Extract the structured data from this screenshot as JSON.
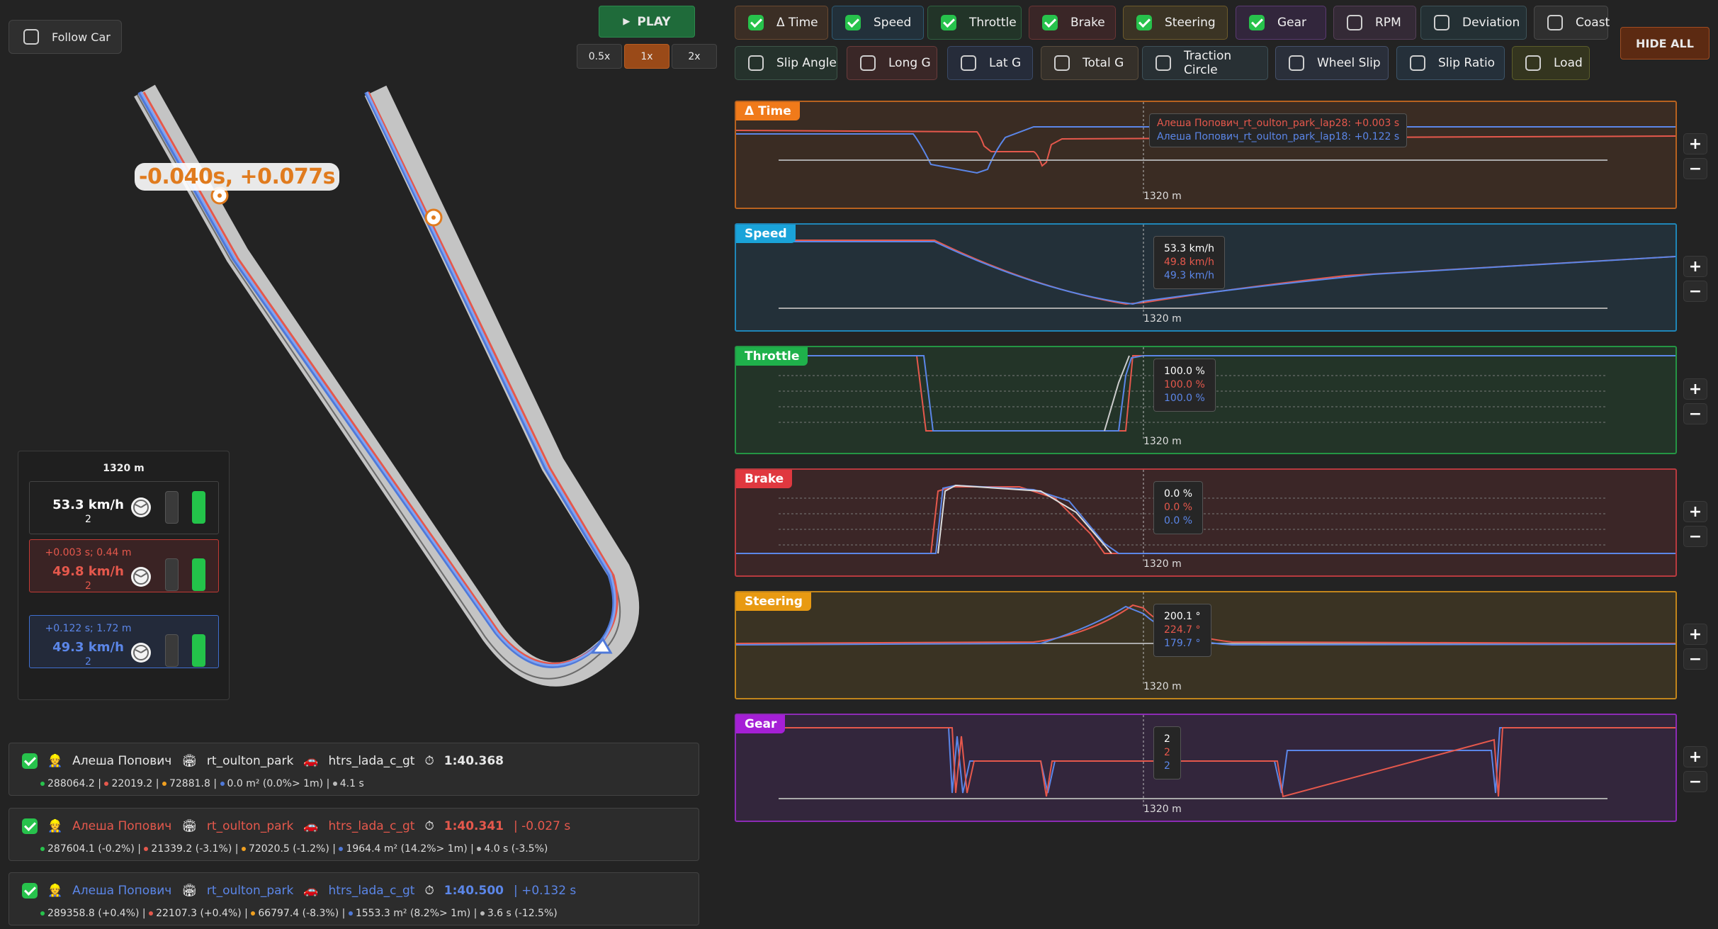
{
  "controls": {
    "follow_car": "Follow Car",
    "play": "PLAY",
    "speeds": [
      "0.5x",
      "1x",
      "2x"
    ],
    "hide_all": "HIDE ALL"
  },
  "toggles": [
    {
      "label": "Δ Time",
      "on": true,
      "bg": "#3b2e25",
      "border": "#6a4a31"
    },
    {
      "label": "Speed",
      "on": true,
      "bg": "#22303a",
      "border": "#2e5a72"
    },
    {
      "label": "Throttle",
      "on": true,
      "bg": "#223428",
      "border": "#2f6140"
    },
    {
      "label": "Brake",
      "on": true,
      "bg": "#3a2627",
      "border": "#6a3535"
    },
    {
      "label": "Steering",
      "on": true,
      "bg": "#3b3424",
      "border": "#6d5b2c"
    },
    {
      "label": "Gear",
      "on": true,
      "bg": "#32263c",
      "border": "#5b3a72"
    },
    {
      "label": "RPM",
      "on": false,
      "bg": "#342a36",
      "border": "#553f57"
    },
    {
      "label": "Deviation",
      "on": false,
      "bg": "#243034",
      "border": "#3d5358"
    },
    {
      "label": "Coast",
      "on": false,
      "bg": "#2f2f2f",
      "border": "#4a4a4a"
    },
    {
      "label": "Slip Angle",
      "on": false,
      "bg": "#25322c",
      "border": "#3d5548"
    },
    {
      "label": "Long G",
      "on": false,
      "bg": "#3a2727",
      "border": "#6a3c3c"
    },
    {
      "label": "Lat G",
      "on": false,
      "bg": "#262c3a",
      "border": "#3a4a66"
    },
    {
      "label": "Total G",
      "on": false,
      "bg": "#35302a",
      "border": "#5a4d3d"
    },
    {
      "label": "Traction Circle",
      "on": false,
      "bg": "#283034",
      "border": "#3e5158"
    },
    {
      "label": "Wheel Slip",
      "on": false,
      "bg": "#2a2f3a",
      "border": "#45506a"
    },
    {
      "label": "Slip Ratio",
      "on": false,
      "bg": "#25303a",
      "border": "#3c5468"
    },
    {
      "label": "Load",
      "on": false,
      "bg": "#34351f",
      "border": "#5b5d2a"
    }
  ],
  "colors": {
    "ref": "#6f8fe6",
    "red": "#e5584c",
    "blue": "#5b86e8",
    "white": "#cfcfcf"
  },
  "map": {
    "callout": "-0.040s, +0.077s"
  },
  "info": {
    "distance": "1320 m",
    "cars": [
      {
        "speed": "53.3 km/h",
        "gear": "2",
        "delta": "",
        "color": "#ffffff"
      },
      {
        "speed": "49.8 km/h",
        "gear": "2",
        "delta": "+0.003 s; 0.44 m",
        "color": "#e5584c"
      },
      {
        "speed": "49.3 km/h",
        "gear": "2",
        "delta": "+0.122 s; 1.72 m",
        "color": "#5b86e8"
      }
    ]
  },
  "laps": [
    {
      "driver": "Алеша Попович",
      "track": "rt_oulton_park",
      "car": "htrs_lada_c_gt",
      "time": "1:40.368",
      "delta": "",
      "stats": [
        "288064.2",
        "22019.2",
        "72881.8",
        "0.0 m² (0.0%> 1m)",
        "4.1 s"
      ],
      "color": "#e8e8e8"
    },
    {
      "driver": "Алеша Попович",
      "track": "rt_oulton_park",
      "car": "htrs_lada_c_gt",
      "time": "1:40.341",
      "delta": "| -0.027 s",
      "stats": [
        "287604.1 (-0.2%)",
        "21339.2 (-3.1%)",
        "72020.5 (-1.2%)",
        "1964.4 m² (14.2%> 1m)",
        "4.0 s (-3.5%)"
      ],
      "color": "#e5584c"
    },
    {
      "driver": "Алеша Попович",
      "track": "rt_oulton_park",
      "car": "htrs_lada_c_gt",
      "time": "1:40.500",
      "delta": "| +0.132 s",
      "stats": [
        "289358.8 (+0.4%)",
        "22107.3 (+0.4%)",
        "66797.4 (-8.3%)",
        "1553.3 m² (8.2%> 1m)",
        "3.6 s (-12.5%)"
      ],
      "color": "#5b86e8"
    }
  ],
  "panels": [
    {
      "id": "dtime",
      "title": "Δ Time",
      "tag": "#f07a1a",
      "bg": "#3a2c23",
      "border": "#b8621f",
      "distance": "1320 m",
      "tooltip": [
        "Алеша Попович_rt_oulton_park_lap28: +0.003 s",
        "Алеша Попович_rt_oulton_park_lap18: +0.122 s"
      ]
    },
    {
      "id": "speed",
      "title": "Speed",
      "tag": "#1aa3d9",
      "bg": "#233039",
      "border": "#1f86b8",
      "distance": "1320 m",
      "tooltip": [
        "53.3 km/h",
        "49.8 km/h",
        "49.3 km/h"
      ]
    },
    {
      "id": "throttle",
      "title": "Throttle",
      "tag": "#1fb14b",
      "bg": "#233428",
      "border": "#249544",
      "distance": "1320 m",
      "tooltip": [
        "100.0 %",
        "100.0 %",
        "100.0 %"
      ]
    },
    {
      "id": "brake",
      "title": "Brake",
      "tag": "#e0383f",
      "bg": "#3b2627",
      "border": "#b83a3f",
      "distance": "1320 m",
      "tooltip": [
        "0.0 %",
        "0.0 %",
        "0.0 %"
      ]
    },
    {
      "id": "steering",
      "title": "Steering",
      "tag": "#e89a12",
      "bg": "#3a3323",
      "border": "#c2851b",
      "distance": "1320 m",
      "tooltip": [
        "200.1 °",
        "224.7 °",
        "179.7 °"
      ]
    },
    {
      "id": "gear",
      "title": "Gear",
      "tag": "#a51fd6",
      "bg": "#33263c",
      "border": "#8c2bb5",
      "distance": "1320 m",
      "tooltip": [
        "2",
        "2",
        "2"
      ]
    }
  ]
}
